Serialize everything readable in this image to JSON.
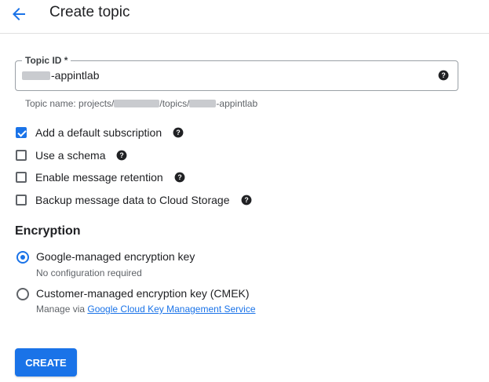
{
  "header": {
    "title": "Create topic",
    "back_icon": "arrow-left-icon"
  },
  "topic_id": {
    "label": "Topic ID *",
    "value_suffix": "-appintlab",
    "help_icon": "help-circle-icon"
  },
  "hint": {
    "prefix": "Topic name: projects/",
    "middle": "/topics/",
    "suffix": "-appintlab"
  },
  "options": [
    {
      "label": "Add a default subscription",
      "checked": true
    },
    {
      "label": "Use a schema",
      "checked": false
    },
    {
      "label": "Enable message retention",
      "checked": false
    },
    {
      "label": "Backup message data to Cloud Storage",
      "checked": false
    }
  ],
  "encryption": {
    "title": "Encryption",
    "google_managed": {
      "label": "Google-managed encryption key",
      "sub": "No configuration required",
      "selected": true
    },
    "customer_managed": {
      "label": "Customer-managed encryption key (CMEK)",
      "sub_prefix": "Manage via ",
      "link": "Google Cloud Key Management Service",
      "selected": false
    }
  },
  "create_button": "CREATE",
  "colors": {
    "accent": "#1a73e8",
    "border": "#9aa0a6",
    "muted": "#5f6368"
  }
}
